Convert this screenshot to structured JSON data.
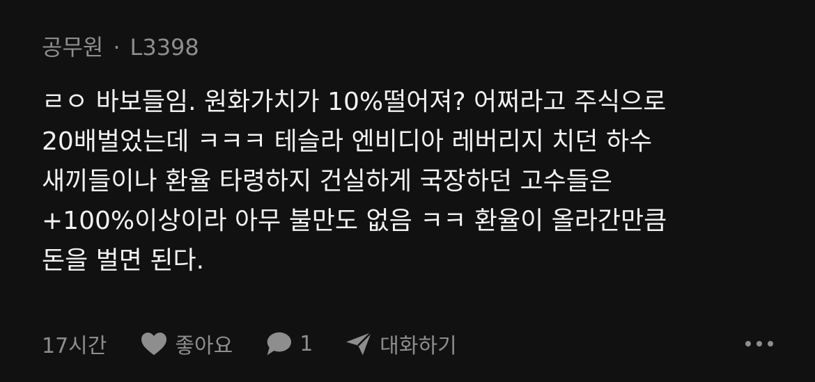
{
  "comment": {
    "author": "공무원",
    "separator": "·",
    "user_id": "L3398",
    "text": "ㄹㅇ 바보들임. 원화가치가 10%떨어져? 어쩌라고 주식으로\n20배벌었는데 ㅋㅋㅋ 테슬라 엔비디아 레버리지 치던 하수\n새끼들이나 환율 타령하지 건실하게 국장하던 고수들은\n+100%이상이라 아무 불만도 없음 ㅋㅋ 환율이 올라간만큼\n돈을 벌면 된다.",
    "time": "17시간",
    "like_label": "좋아요",
    "reply_count": "1",
    "chat_label": "대화하기"
  },
  "colors": {
    "background": "#111111",
    "text": "#f2f2f2",
    "muted": "#8e8e8e"
  },
  "icons": {
    "like": "heart-icon",
    "reply": "speech-bubble-icon",
    "chat": "paper-plane-icon",
    "more": "more-dots-icon"
  }
}
